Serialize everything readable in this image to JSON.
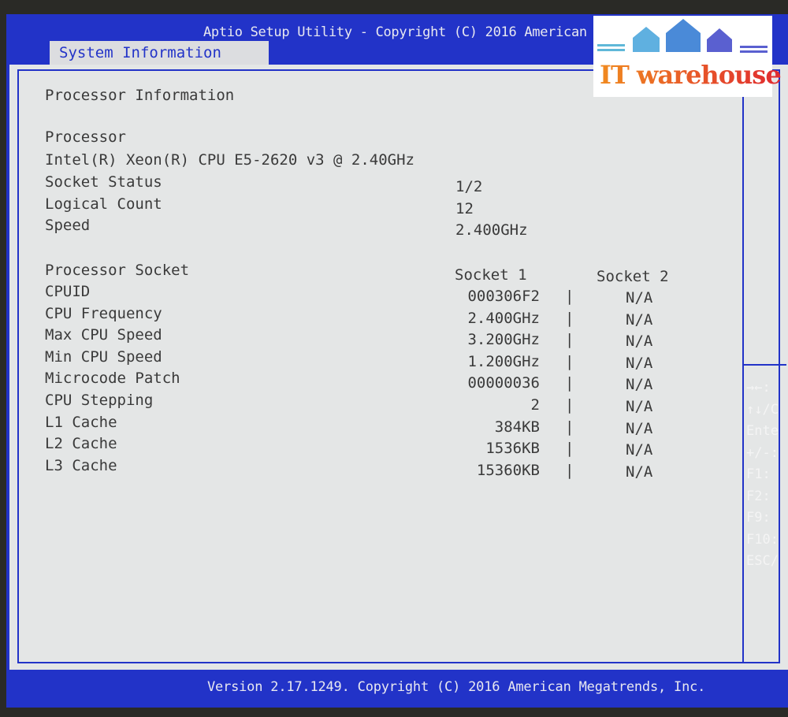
{
  "header": {
    "title": "Aptio Setup Utility - Copyright (C) 2016 American Megatrends, Inc.",
    "active_tab": "System Information"
  },
  "section_title": "Processor Information",
  "processor": {
    "label": "Processor",
    "name": "Intel(R) Xeon(R) CPU E5-2620 v3 @ 2.40GHz"
  },
  "summary": [
    {
      "label": "Socket Status",
      "value": "1/2"
    },
    {
      "label": "Logical Count",
      "value": "12"
    },
    {
      "label": "Speed",
      "value": "2.400GHz"
    }
  ],
  "socket_table": {
    "header": {
      "label": "Processor Socket",
      "col1": "Socket 1",
      "col2": "Socket 2"
    },
    "separator": "|",
    "rows": [
      {
        "label": "CPUID",
        "s1": "000306F2",
        "s2": "N/A"
      },
      {
        "label": "CPU Frequency",
        "s1": "2.400GHz",
        "s2": "N/A"
      },
      {
        "label": "Max CPU Speed",
        "s1": "3.200GHz",
        "s2": "N/A"
      },
      {
        "label": "Min CPU Speed",
        "s1": "1.200GHz",
        "s2": "N/A"
      },
      {
        "label": "Microcode Patch",
        "s1": "00000036",
        "s2": "N/A"
      },
      {
        "label": "CPU Stepping",
        "s1": "2",
        "s2": "N/A"
      },
      {
        "label": "L1 Cache",
        "s1": "384KB",
        "s2": "N/A"
      },
      {
        "label": "L2 Cache",
        "s1": "1536KB",
        "s2": "N/A"
      },
      {
        "label": "L3 Cache",
        "s1": "15360KB",
        "s2": "N/A"
      }
    ]
  },
  "help_keys": [
    "→←:",
    "↑↓/C",
    "Ente",
    "+/-:",
    "F1: ",
    "F2: ",
    "F9: ",
    "F10:",
    "ESC/"
  ],
  "footer": "Version 2.17.1249. Copyright (C) 2016 American Megatrends, Inc.",
  "watermark": {
    "text": "IT warehouse",
    "icon": "houses-logo"
  },
  "colors": {
    "header_blue": "#2233c8",
    "panel": "#e4e6e6"
  }
}
